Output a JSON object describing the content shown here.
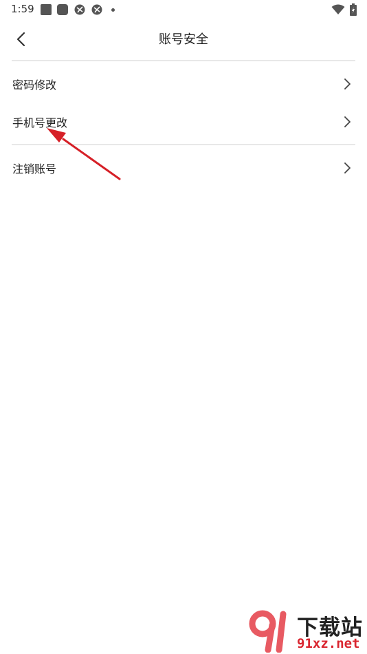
{
  "status_bar": {
    "time": "1:59"
  },
  "header": {
    "title": "账号安全",
    "back_icon": "chevron-left-icon"
  },
  "menu": {
    "items": [
      {
        "label": "密码修改",
        "icon": "chevron-right-icon"
      },
      {
        "label": "手机号更改",
        "icon": "chevron-right-icon"
      },
      {
        "label": "注销账号",
        "icon": "chevron-right-icon"
      }
    ]
  },
  "colors": {
    "annotation_arrow": "#d62027",
    "divider": "#e8e8e8",
    "watermark_accent": "#d9252f"
  },
  "watermark": {
    "title": "下载站",
    "domain": "91xz.net"
  }
}
